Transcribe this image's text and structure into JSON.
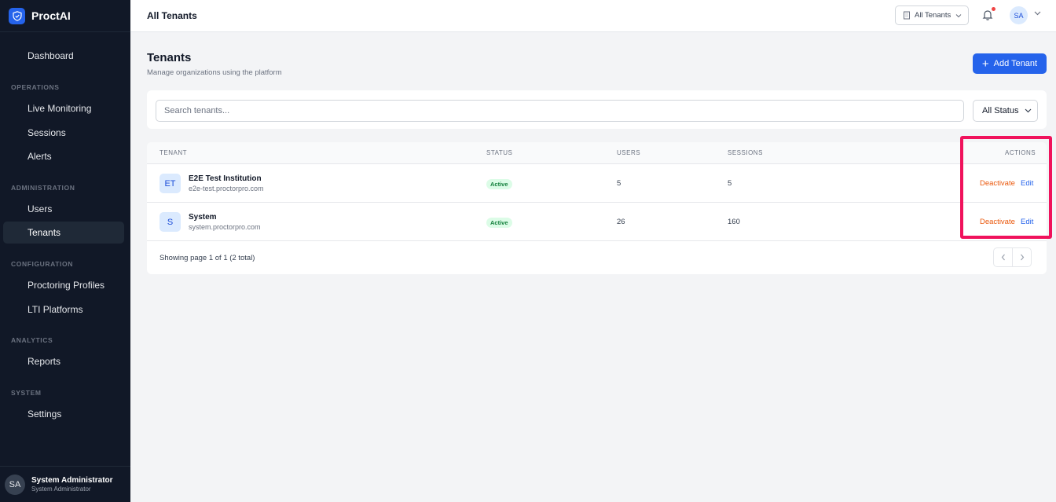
{
  "app": {
    "name": "ProctAI"
  },
  "sidebar": {
    "items": [
      {
        "label": "Dashboard"
      },
      {
        "label": "Live Monitoring"
      },
      {
        "label": "Sessions"
      },
      {
        "label": "Alerts"
      },
      {
        "label": "Users"
      },
      {
        "label": "Tenants"
      },
      {
        "label": "Proctoring Profiles"
      },
      {
        "label": "LTI Platforms"
      },
      {
        "label": "Reports"
      },
      {
        "label": "Settings"
      }
    ],
    "sections": [
      "OPERATIONS",
      "ADMINISTRATION",
      "CONFIGURATION",
      "ANALYTICS",
      "SYSTEM"
    ],
    "user": {
      "initials": "SA",
      "name": "System Administrator",
      "role": "System Administrator"
    }
  },
  "topbar": {
    "title": "All Tenants",
    "tenant_select": "All Tenants",
    "avatar_initials": "SA"
  },
  "page": {
    "title": "Tenants",
    "subtitle": "Manage organizations using the platform",
    "add_button": "Add Tenant"
  },
  "filters": {
    "search_placeholder": "Search tenants...",
    "status_select": "All Status"
  },
  "table": {
    "headers": {
      "tenant": "TENANT",
      "status": "STATUS",
      "users": "USERS",
      "sessions": "SESSIONS",
      "actions": "ACTIONS"
    },
    "rows": [
      {
        "initials": "ET",
        "name": "E2E Test Institution",
        "domain": "e2e-test.proctorpro.com",
        "status": "Active",
        "users": "5",
        "sessions": "5",
        "deactivate": "Deactivate",
        "edit": "Edit"
      },
      {
        "initials": "S",
        "name": "System",
        "domain": "system.proctorpro.com",
        "status": "Active",
        "users": "26",
        "sessions": "160",
        "deactivate": "Deactivate",
        "edit": "Edit"
      }
    ],
    "footer": "Showing page 1 of 1 (2 total)"
  },
  "colors": {
    "accent": "#2563eb",
    "sidebar_bg": "#111827",
    "highlight": "#f0125c",
    "deactivate": "#ea580c",
    "active_badge": "#dcfce7"
  }
}
